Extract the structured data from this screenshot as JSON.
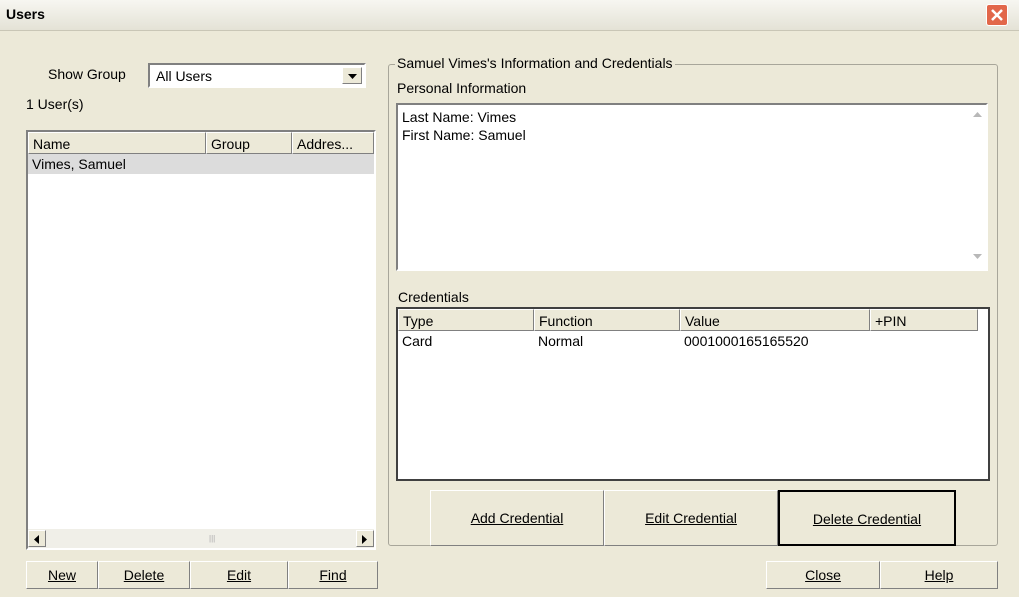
{
  "window": {
    "title": "Users"
  },
  "left": {
    "show_group_label": "Show Group",
    "group_select": {
      "value": "All Users"
    },
    "user_count": "1 User(s)",
    "columns": [
      "Name",
      "Group",
      "Addres..."
    ],
    "rows": [
      {
        "name": "Vimes, Samuel",
        "group": "",
        "address": ""
      }
    ],
    "buttons": {
      "new": "New",
      "delete": "Delete",
      "edit": "Edit",
      "find": "Find"
    }
  },
  "right": {
    "group_title": "Samuel Vimes's Information and Credentials",
    "personal_label": "Personal Information",
    "personal_lines": [
      "Last Name: Vimes",
      "First Name: Samuel"
    ],
    "credentials_label": "Credentials",
    "cred_columns": [
      "Type",
      "Function",
      "Value",
      "+PIN"
    ],
    "cred_rows": [
      {
        "type": "Card",
        "function": "Normal",
        "value": "0001000165165520",
        "pin": ""
      }
    ],
    "actions": {
      "add": "Add Credential",
      "edit": "Edit Credential",
      "delete": "Delete Credential"
    }
  },
  "footer": {
    "close": "Close",
    "help": "Help"
  },
  "colors": {
    "dialog_bg": "#ece9d8",
    "selected_row": "#dcdcdc",
    "close_button": "#e2674a"
  },
  "icons": [
    "close-icon",
    "dropdown-arrow-icon",
    "scroll-left-icon",
    "scroll-right-icon",
    "scroll-up-icon",
    "scroll-down-icon"
  ]
}
